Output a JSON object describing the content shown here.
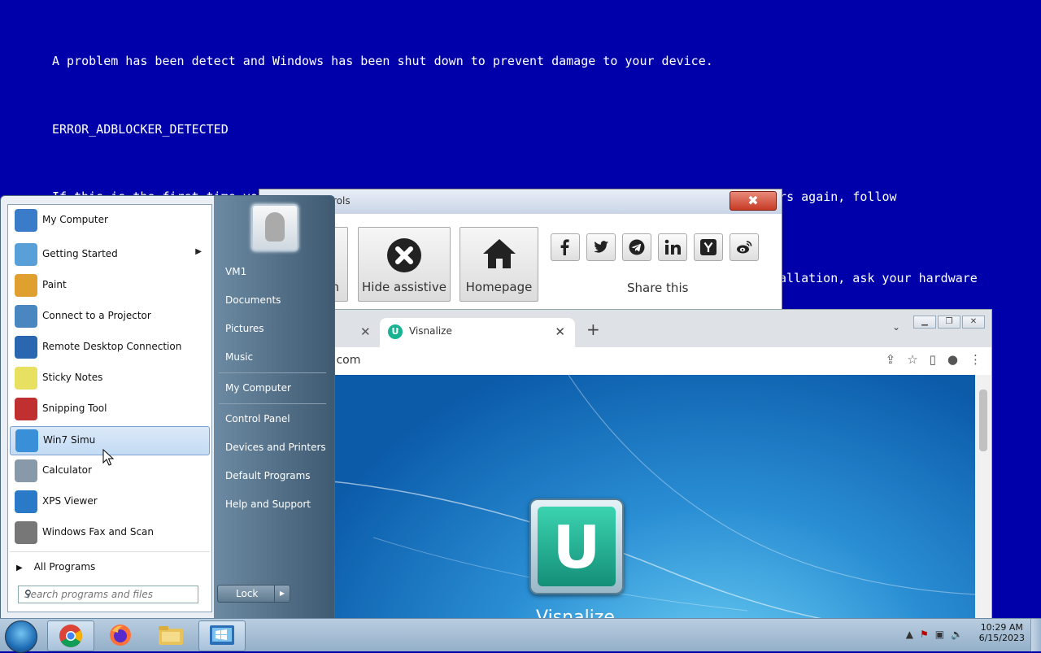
{
  "bsod": {
    "line1": "A problem has been detect and Windows has been shut down to prevent damage to your device.",
    "line2": "ERROR_ADBLOCKER_DETECTED",
    "line3": "If this is the first time you've seen this Stop error screen, restart the app. If this screen appears again, follow",
    "line4": "allation, ask your hardware"
  },
  "assist_window": {
    "title_fragment": "rols",
    "close_label": "✖",
    "btn_partial_label": "n",
    "hide_label": "Hide assistive",
    "home_label": "Homepage",
    "share_label": "Share this",
    "share_icons": [
      "facebook-icon",
      "twitter-icon",
      "telegram-icon",
      "linkedin-icon",
      "ycombinator-icon",
      "weibo-icon"
    ]
  },
  "browser": {
    "tab_title": "Visnalize",
    "tab_icon": "U",
    "url": ".com",
    "new_tab": "+",
    "page_name": "Visnalize",
    "logo_letter": "U",
    "window_buttons": [
      "▁",
      "❐",
      "✕"
    ]
  },
  "start_menu": {
    "programs": [
      {
        "name": "My Computer",
        "icon_color": "#3a7cc9"
      },
      {
        "name": "Getting Started",
        "icon_color": "#5aa0d8",
        "arrow": "▶"
      },
      {
        "name": "Paint",
        "icon_color": "#e0a030"
      },
      {
        "name": "Connect to a Projector",
        "icon_color": "#4a86c0"
      },
      {
        "name": "Remote Desktop Connection",
        "icon_color": "#2b66b0"
      },
      {
        "name": "Sticky Notes",
        "icon_color": "#e8e060"
      },
      {
        "name": "Snipping Tool",
        "icon_color": "#c03030"
      },
      {
        "name": "Win7 Simu",
        "icon_color": "#3a90d8"
      },
      {
        "name": "Calculator",
        "icon_color": "#8899aa"
      },
      {
        "name": "XPS Viewer",
        "icon_color": "#2a7ac8"
      },
      {
        "name": "Windows Fax and Scan",
        "icon_color": "#777777"
      }
    ],
    "all_programs": "All Programs",
    "search_placeholder": "Search programs and files",
    "right_links": [
      "VM1",
      "Documents",
      "Pictures",
      "Music",
      "My Computer",
      "Control Panel",
      "Devices and Printers",
      "Default Programs",
      "Help and Support"
    ],
    "lock_label": "Lock"
  },
  "taskbar": {
    "time": "10:29 AM",
    "date": "6/15/2023",
    "apps": [
      "chrome-icon",
      "firefox-icon",
      "explorer-icon",
      "win7simu-icon"
    ]
  }
}
